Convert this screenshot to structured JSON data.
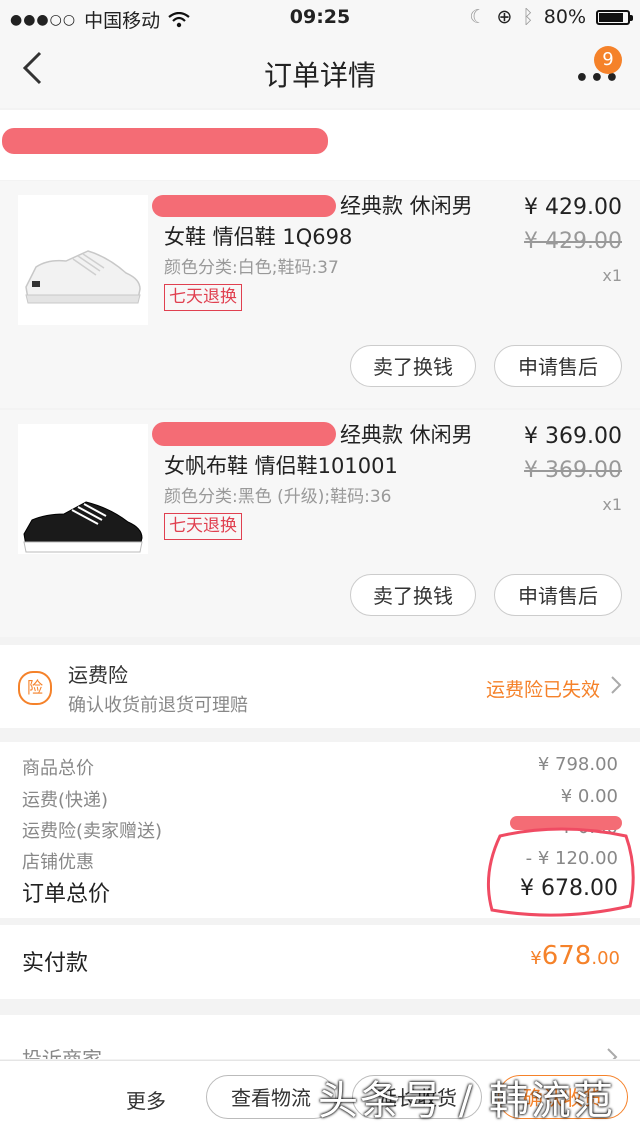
{
  "status_bar": {
    "carrier": "中国移动",
    "time": "09:25",
    "battery": "80%",
    "battery_level": 0.8
  },
  "nav": {
    "title": "订单详情",
    "badge_count": "9"
  },
  "items": [
    {
      "title": "经典款 休闲男女鞋 情侣鞋 1Q698",
      "title_line1": "经典款 休闲男",
      "title_line2": "女鞋 情侣鞋 1Q698",
      "sku": "颜色分类:白色;鞋码:37",
      "tag": "七天退换",
      "price": "¥ 429.00",
      "original_price": "¥ 429.00",
      "quantity": "x1",
      "btn_sell": "卖了换钱",
      "btn_after_sale": "申请售后",
      "shoe_color": "#ffffff"
    },
    {
      "title": "经典款 休闲男女帆布鞋 情侣鞋101001",
      "title_line1": "经典款 休闲男",
      "title_line2": "女帆布鞋  情侣鞋101001",
      "sku": "颜色分类:黑色 (升级);鞋码:36",
      "tag": "七天退换",
      "price": "¥ 369.00",
      "original_price": "¥ 369.00",
      "quantity": "x1",
      "btn_sell": "卖了换钱",
      "btn_after_sale": "申请售后",
      "shoe_color": "#1a1a1a"
    }
  ],
  "insurance": {
    "icon_text": "险",
    "title": "运费险",
    "subtitle": "确认收货前退货可理赔",
    "status": "运费险已失效"
  },
  "summary": {
    "rows": [
      {
        "label": "商品总价",
        "value": "¥ 798.00"
      },
      {
        "label": "运费(快递)",
        "value": "¥ 0.00"
      },
      {
        "label": "运费险(卖家赠送)",
        "value": "¥ 0.00"
      },
      {
        "label": "店铺优惠",
        "value": "- ¥ 120.00"
      }
    ],
    "total_label": "订单总价",
    "total_value": "¥ 678.00"
  },
  "paid": {
    "label": "实付款",
    "symbol": "¥",
    "amount": "678",
    "cents": ".00"
  },
  "complain_label": "投诉商家",
  "bottom_bar": {
    "more": "更多",
    "logistics": "查看物流",
    "third_btn": "延长收货",
    "confirm": "确认收货"
  },
  "watermark": "头条号 / 韩流范",
  "colors": {
    "accent": "#f5822a",
    "redaction": "#f46c75",
    "tag": "#e04050"
  }
}
